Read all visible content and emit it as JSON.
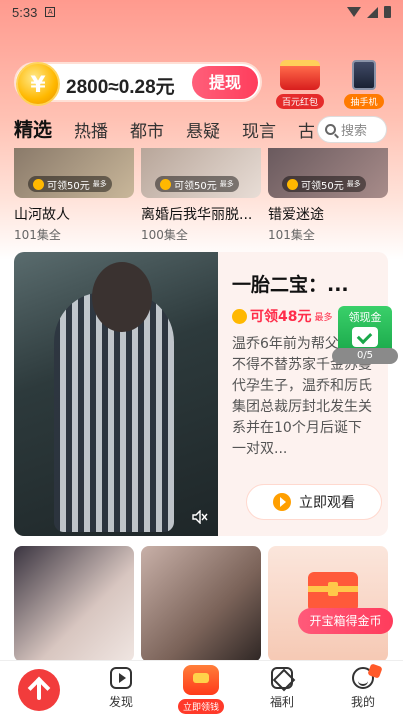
{
  "status_bar": {
    "time": "5:33",
    "notification_icon": "A"
  },
  "coin_bar": {
    "coin_symbol": "¥",
    "balance_text": "2800≈0.28元",
    "withdraw_label": "提现"
  },
  "rewards": [
    {
      "label": "百元红包"
    },
    {
      "label": "抽手机"
    }
  ],
  "tabs": [
    {
      "label": "精选",
      "active": true
    },
    {
      "label": "热播"
    },
    {
      "label": "都市"
    },
    {
      "label": "悬疑"
    },
    {
      "label": "现言"
    },
    {
      "label": "古"
    }
  ],
  "search": {
    "placeholder": "搜索"
  },
  "top_row": [
    {
      "title": "山河故人",
      "episodes": "101集全",
      "badge": "可领50元",
      "badge_small": "最多"
    },
    {
      "title": "离婚后我华丽脱...",
      "episodes": "100集全",
      "badge": "可领50元",
      "badge_small": "最多"
    },
    {
      "title": "错爱迷途",
      "episodes": "101集全",
      "badge": "可领50元",
      "badge_small": "最多"
    }
  ],
  "feature": {
    "title": "一胎二宝：...",
    "coin_text": "可领48元",
    "coin_small": "最多",
    "description": "温乔6年前为帮父还债不得不替苏家千金苏曼代孕生子，温乔和厉氏集团总裁厉封北发生关系并在10个月后诞下一对双...",
    "watch_label": "立即观看",
    "cash_badge": "领现金",
    "progress_text": "0/5"
  },
  "treasure_button": "开宝箱得金币",
  "bottom_nav": {
    "discover": "发现",
    "claim": "立即领钱",
    "welfare": "福利",
    "mine": "我的"
  }
}
